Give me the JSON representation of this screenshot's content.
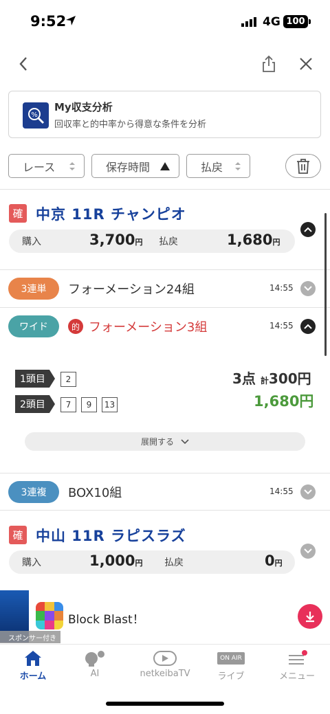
{
  "status": {
    "time": "9:52",
    "network": "4G",
    "battery": "100"
  },
  "analysis": {
    "title": "My収支分析",
    "subtitle": "回収率と的中率から得意な条件を分析"
  },
  "filters": {
    "race": "レース",
    "saved_time": "保存時間",
    "payout": "払戻"
  },
  "races": [
    {
      "badge": "確",
      "title": "中京 11R チャンピオ",
      "purchase_label": "購入",
      "purchase": "3,700",
      "unit": "円",
      "payout_label": "払戻",
      "payout": "1,680",
      "bets": [
        {
          "type": "3連単",
          "color": "#e8844a",
          "name": "フォーメーション24組",
          "time": "14:55"
        },
        {
          "type": "ワイド",
          "color": "#4aa3a6",
          "hit": "的",
          "name": "フォーメーション3組",
          "time": "14:55"
        },
        {
          "type": "3連複",
          "color": "#4b90c0",
          "name": "BOX10組",
          "time": "14:55"
        }
      ],
      "detail": {
        "first_label": "1頭目",
        "first": [
          "2"
        ],
        "second_label": "2頭目",
        "second": [
          "7",
          "9",
          "13"
        ],
        "points": "3点",
        "total_prefix": "計",
        "total": "300円",
        "return": "1,680円",
        "expand": "展開する"
      }
    },
    {
      "badge": "確",
      "title": "中山 11R ラピスラズ",
      "purchase_label": "購入",
      "purchase": "1,000",
      "unit": "円",
      "payout_label": "払戻",
      "payout": "0"
    }
  ],
  "sponsor": {
    "tag": "スポンサー付き",
    "app_name": "Block Blast！"
  },
  "tabs": [
    {
      "label": "ホーム",
      "icon": "home-icon",
      "active": true
    },
    {
      "label": "AI",
      "icon": "ai-icon"
    },
    {
      "label": "netkeibaTV",
      "icon": "tv-icon"
    },
    {
      "label": "ライブ",
      "icon": "live-icon",
      "badge": "ON AIR"
    },
    {
      "label": "メニュー",
      "icon": "menu-icon"
    }
  ],
  "colors": {
    "accent": "#17419b",
    "win": "#4c9a3c",
    "badge": "#e45a5a",
    "hit": "#d43a3a"
  }
}
